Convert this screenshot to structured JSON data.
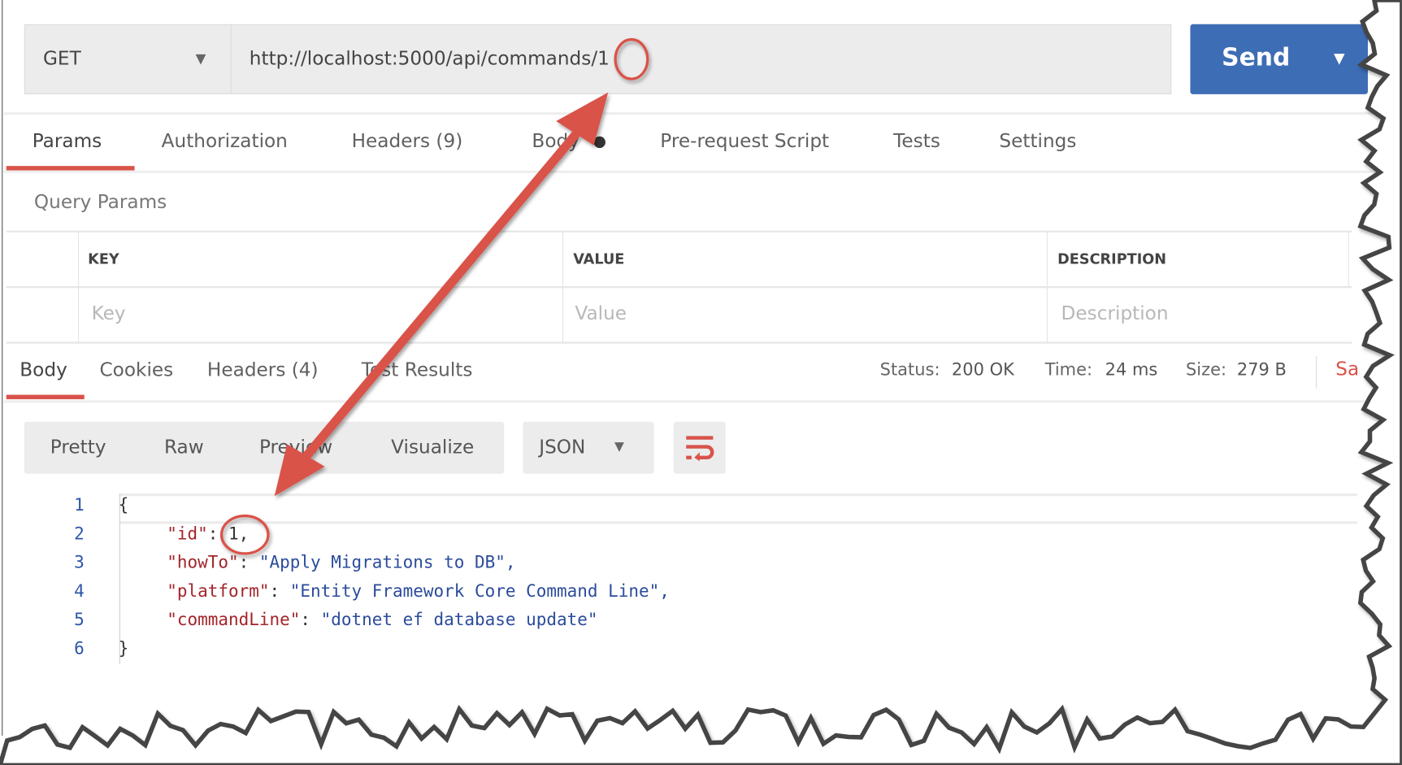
{
  "request": {
    "method": "GET",
    "url": "http://localhost:5000/api/commands/1",
    "send_label": "Send"
  },
  "request_tabs": [
    {
      "label": "Params",
      "active": true
    },
    {
      "label": "Authorization"
    },
    {
      "label": "Headers (9)"
    },
    {
      "label": "Body"
    },
    {
      "label": "Pre-request Script"
    },
    {
      "label": "Tests"
    },
    {
      "label": "Settings"
    }
  ],
  "query_params": {
    "title": "Query Params",
    "columns": [
      "KEY",
      "VALUE",
      "DESCRIPTION"
    ],
    "placeholders": [
      "Key",
      "Value",
      "Description"
    ]
  },
  "response_tabs": [
    {
      "label": "Body",
      "active": true
    },
    {
      "label": "Cookies"
    },
    {
      "label": "Headers (4)"
    },
    {
      "label": "Test Results"
    }
  ],
  "response_meta": {
    "status_label": "Status:",
    "status": "200 OK",
    "time_label": "Time:",
    "time": "24 ms",
    "size_label": "Size:",
    "size": "279 B",
    "save_label": "Sa"
  },
  "view_modes": [
    "Pretty",
    "Raw",
    "Preview",
    "Visualize"
  ],
  "format": "JSON",
  "icons": {
    "wrap": "wrap-lines-icon",
    "caret": "caret-down-icon"
  },
  "colors": {
    "send": "#3d6db5",
    "accent": "#d9534a",
    "key": "#a3252b",
    "string": "#2b4c9b"
  },
  "code_lines": [
    {
      "n": "1",
      "text": "{"
    },
    {
      "n": "2",
      "key": "\"id\"",
      "value": "1,"
    },
    {
      "n": "3",
      "key": "\"howTo\"",
      "value": "\"Apply Migrations to DB\","
    },
    {
      "n": "4",
      "key": "\"platform\"",
      "value": "\"Entity Framework Core Command Line\","
    },
    {
      "n": "5",
      "key": "\"commandLine\"",
      "value": "\"dotnet ef database update\""
    },
    {
      "n": "6",
      "text": "}"
    }
  ]
}
